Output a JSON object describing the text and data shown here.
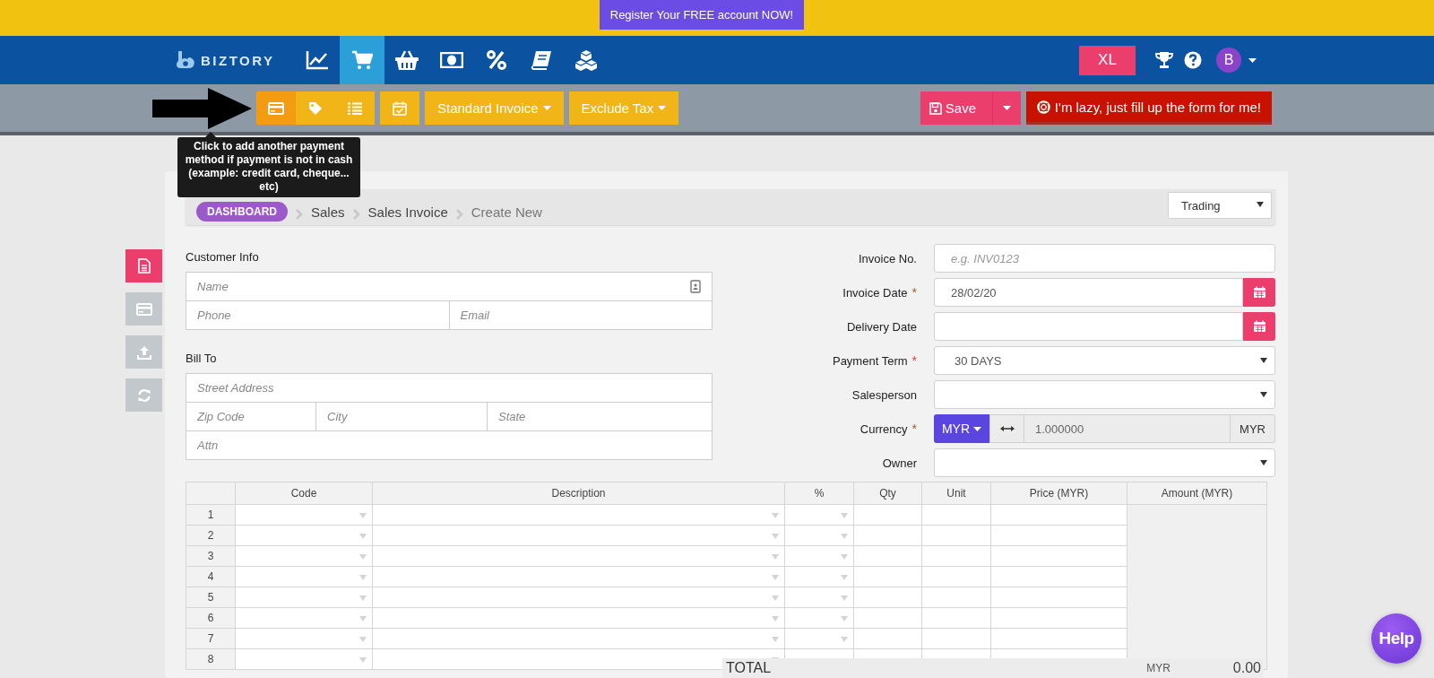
{
  "banner": {
    "button": "Register Your FREE account NOW!"
  },
  "nav": {
    "logo": "BIZTORY",
    "items": [
      {
        "selected": false
      },
      {
        "selected": true
      },
      {
        "selected": false
      },
      {
        "selected": false
      },
      {
        "selected": false
      },
      {
        "selected": false
      },
      {
        "selected": false
      }
    ],
    "plan": "XL",
    "avatar": "B"
  },
  "toolbar": {
    "icon_buttons": [
      {
        "selected": true
      },
      {
        "selected": false
      },
      {
        "selected": false
      }
    ],
    "dropdowns": [
      "Standard Invoice",
      "Exclude Tax"
    ],
    "save": "Save",
    "lazy": "I'm lazy, just fill up the form for me!"
  },
  "tooltip": "Click to add another payment method if payment is not in cash (example: credit card, cheque... etc)",
  "breadcrumb": [
    "DASHBOARD",
    "Sales",
    "Sales Invoice",
    "Create New"
  ],
  "business_type": "Trading",
  "side_tabs": [
    {
      "selected": true
    },
    {
      "selected": false
    },
    {
      "selected": false
    },
    {
      "selected": false
    }
  ],
  "customer_info": {
    "title": "Customer Info",
    "name": {
      "placeholder": "Name"
    },
    "phone": {
      "placeholder": "Phone"
    },
    "email": {
      "placeholder": "Email"
    }
  },
  "bill_to": {
    "title": "Bill To",
    "street": {
      "placeholder": "Street Address"
    },
    "zip": {
      "placeholder": "Zip Code"
    },
    "city": {
      "placeholder": "City"
    },
    "state": {
      "placeholder": "State"
    },
    "attn": {
      "placeholder": "Attn"
    }
  },
  "invoice_fields": [
    {
      "label": "Invoice No.",
      "kind": "text",
      "placeholder": "e.g. INV0123"
    },
    {
      "label": "Invoice Date",
      "required_mark": "*",
      "kind": "date",
      "value": "28/02/20"
    },
    {
      "label": "Delivery Date",
      "kind": "date"
    },
    {
      "label": "Payment Term",
      "required_mark": "*",
      "kind": "select",
      "value": "30 DAYS"
    },
    {
      "label": "Salesperson",
      "kind": "select"
    },
    {
      "label": "Currency",
      "required_mark": "*",
      "kind": "currency",
      "currency": "MYR",
      "rate": "1.000000",
      "base": "MYR"
    },
    {
      "label": "Owner",
      "kind": "select"
    }
  ],
  "items_table": {
    "columns": [
      "Code",
      "Description",
      "%",
      "Qty",
      "Unit",
      "Price (MYR)",
      "Amount (MYR)"
    ],
    "rows": [
      "1",
      "2",
      "3",
      "4",
      "5",
      "6",
      "7",
      "8"
    ],
    "total": {
      "label": "TOTAL",
      "currency": "MYR",
      "amount": "0.00"
    }
  },
  "help_button": "Help"
}
